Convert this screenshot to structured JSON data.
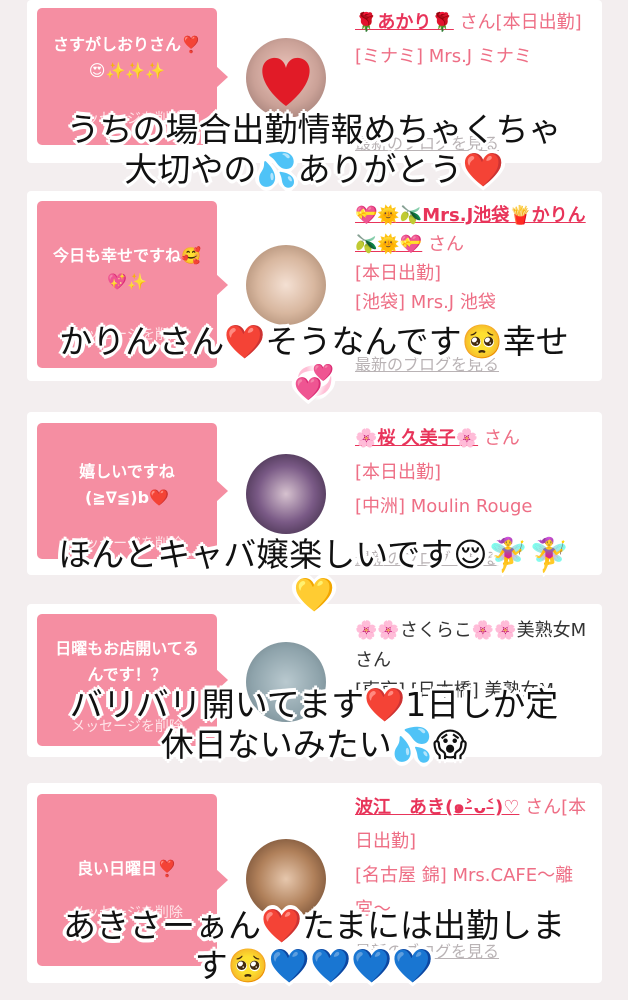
{
  "cards": [
    {
      "bubble": "さすがしおりさん❣️😍✨✨✨",
      "delete_label": "メッセージを削除",
      "name": "🌹あかり🌹",
      "suffix": "さん[本日出勤]",
      "shop": "[ミナミ] Mrs.J ミナミ",
      "blog_label": "最新のブログを見る"
    },
    {
      "bubble": "今日も幸せですね🥰💖✨",
      "delete_label": "メッセージを削除",
      "name": "💝🌞🫒Mrs.J池袋🍟かりん🫒🌞💝",
      "suffix": "さん",
      "status": "[本日出勤]",
      "shop": "[池袋] Mrs.J 池袋",
      "blog_label": "最新のブログを見る"
    },
    {
      "bubble": "嬉しいですね(≧∇≦)b❤️",
      "delete_label": "メッセージを削除",
      "name": "🌸桜 久美子🌸",
      "suffix": "さん",
      "status": "[本日出勤]",
      "shop": "[中洲] Moulin Rouge",
      "blog_label": "最新のブログを見る"
    },
    {
      "bubble": "日曜もお店開いてるんです！？",
      "delete_label": "メッセージを削除",
      "name": "🌸🌸さくらこ🌸🌸美熟女Mさん",
      "shop": "[東京] [日本橋] 美熟女M"
    },
    {
      "bubble": "良い日曜日❣️",
      "delete_label": "メッセージを削除",
      "name": "波江　あき(๑˃̵ᴗ˂̵)♡",
      "suffix": "さん[本日出勤]",
      "shop": "[名古屋 錦] Mrs.CAFE〜離宮〜",
      "blog_label": "最新のブログを見る"
    }
  ],
  "overlays": [
    "うちの場合出勤情報めちゃくちゃ\n大切やの💦ありがとう❤️",
    "かりんさん❤️そうなんです🥺幸せ\n💞",
    "ほんとキャバ嬢楽しいです😌🧚‍♀️🧚‍♀️\n💛",
    "バリバリ開いてます❤️1日しか定\n休日ないみたい💦😱",
    "あきさーぁん❤️たまには出勤しま\nす🥺💙💙💙💙"
  ],
  "colors": {
    "bubble": "#f58ea2",
    "name": "#e8345a",
    "info": "#ee6e85",
    "background": "#f3eeef"
  }
}
